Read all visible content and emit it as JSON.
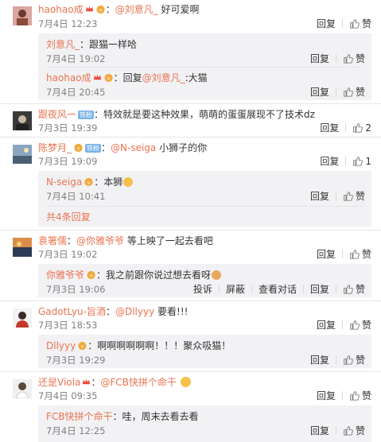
{
  "labels": {
    "reply": "回复",
    "like": "赞",
    "report": "投诉",
    "block": "屏蔽",
    "view_dialog": "查看对话"
  },
  "comments": [
    {
      "user": "haohao成",
      "sep": "：",
      "mention": "@刘意凡_",
      "text": " 好可爱啊",
      "time": "7月4日 12:23",
      "likes": "",
      "subs": [
        {
          "user": "刘意凡_",
          "sep": "：",
          "text": "跟猫一样哈",
          "time": "7月4日 19:02",
          "likes": ""
        },
        {
          "user": "haohao成",
          "sep": "：回复",
          "mention": "@刘意凡_",
          "text": ":大猫",
          "time": "7月4日 20:45",
          "likes": ""
        }
      ]
    },
    {
      "user": "跟夜风一",
      "tag": "铁粉",
      "sep": "：",
      "text": "特效就是要这种效果，萌萌的蛋蛋展现不了技术dz",
      "time": "7月3日 19:39",
      "likes": "2"
    },
    {
      "user": "陈梦月_",
      "tag": "铁粉",
      "sep": "：",
      "mention": "@N-seiga",
      "text": " 小狮子的你",
      "time": "7月3日 19:09",
      "likes": "1",
      "subs": [
        {
          "user": "N-seiga",
          "sep": "：",
          "text": "本狮",
          "time": "7月4日 10:41",
          "likes": ""
        }
      ],
      "more": "共4条回复"
    },
    {
      "user": "袁箸儒",
      "sep": "：",
      "mention": "@你雅爷爷",
      "text": " 等上映了一起去看吧",
      "time": "7月3日 19:02",
      "likes": "",
      "subs": [
        {
          "user": "你雅爷爷",
          "sep": "：",
          "text": "我之前跟你说过想去看呀",
          "time": "7月3日 19:06",
          "likes": "",
          "extra": true
        }
      ]
    },
    {
      "user": "GadotLyu-旨酒",
      "sep": "：",
      "mention": "@Dllyyy",
      "text": " 要看!!!",
      "time": "7月3日 18:53",
      "likes": "",
      "subs": [
        {
          "user": "Dllyyy",
          "sep": "：",
          "text": "啊啊啊啊啊啊！！！聚众吸猫！",
          "time": "7月3日 19:29",
          "likes": ""
        }
      ]
    },
    {
      "user": "还是Viola",
      "sep": "：",
      "mention": "@FCB快拼个命干",
      "text": " ",
      "time": "7月4日 09:35",
      "likes": "",
      "subs": [
        {
          "user": "FCB快拼个命干",
          "sep": "：",
          "text": "哇，周末去看去看",
          "time": "7月4日 12:25",
          "likes": ""
        }
      ]
    }
  ],
  "colors": {
    "link": "#eb7350",
    "text": "#333333",
    "meta": "#808080",
    "subbox": "#f2f2f5"
  }
}
